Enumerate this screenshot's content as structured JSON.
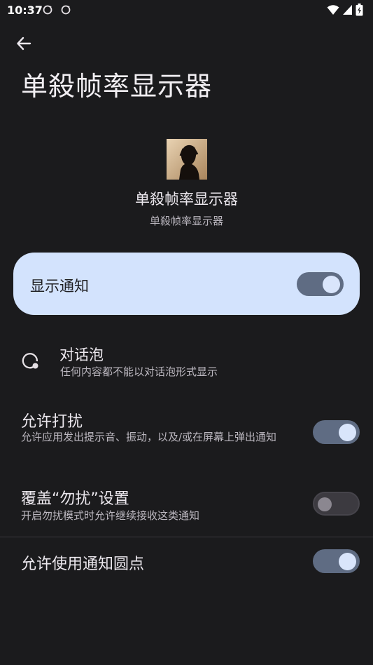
{
  "status_bar": {
    "time": "10:37",
    "icons": [
      "sync-icon",
      "sync-icon",
      "wifi-icon",
      "cell-signal-icon",
      "battery-icon"
    ]
  },
  "header": {
    "back_icon": "arrow-back-icon",
    "title": "单殺帧率显示器"
  },
  "app": {
    "name": "单殺帧率显示器",
    "subtitle": "单殺帧率显示器",
    "icon": "app-avatar-icon"
  },
  "master_toggle": {
    "label": "显示通知",
    "checked": true
  },
  "settings": {
    "bubbles": {
      "title": "对话泡",
      "subtitle": "任何内容都不能以对话泡形式显示",
      "icon": "bubble-icon"
    },
    "allow_interrupt": {
      "title": "允许打扰",
      "subtitle": "允许应用发出提示音、振动，以及/或在屏幕上弹出通知",
      "checked": true
    },
    "override_dnd": {
      "title": "覆盖“勿扰”设置",
      "subtitle": "开启勿扰模式时允许继续接收这类通知",
      "checked": false
    },
    "notification_dot": {
      "title": "允许使用通知圆点",
      "checked": true
    }
  },
  "colors": {
    "background": "#1b1b1d",
    "card": "#d3e3fd",
    "switch_on_track": "#5f6c83",
    "switch_on_knob": "#d9e5fb",
    "switch_off_track": "#3c3a40"
  }
}
